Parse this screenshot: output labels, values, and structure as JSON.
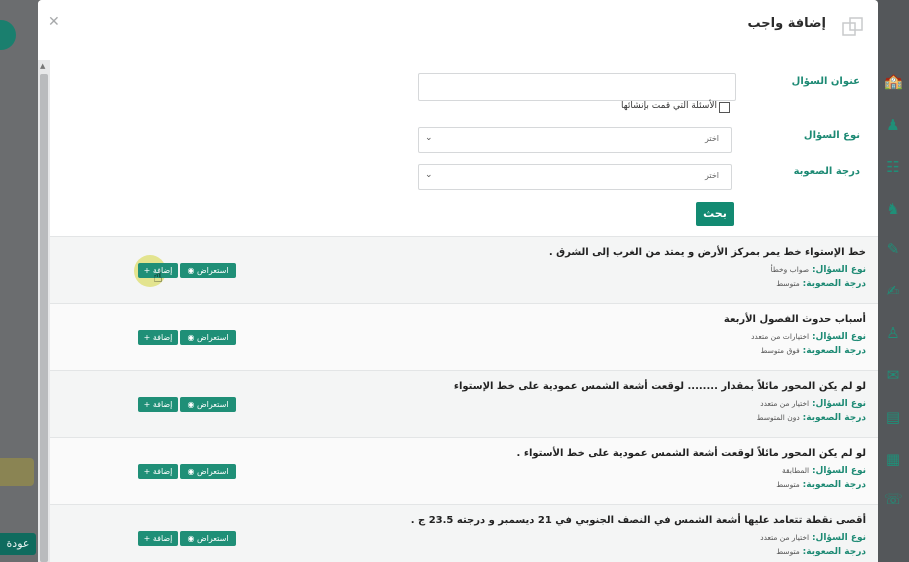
{
  "background": {
    "back_button_label": "عودة"
  },
  "modal": {
    "title": "إضافة واجب",
    "title_icon": "copy-icon",
    "close_icon": "close-icon"
  },
  "form": {
    "question_title_label": "عنوان السؤال",
    "question_title_value": "",
    "my_questions_checkbox_label": "الأسئلة التي قمت بإنشائها",
    "question_type_label": "نوع السؤال",
    "question_type_value": "اختر",
    "difficulty_label": "درجة الصعوبة",
    "difficulty_value": "اختر",
    "search_button": "بحث"
  },
  "meta_labels": {
    "type": "نوع السؤال:",
    "difficulty": "درجة الصعوبة:"
  },
  "actions": {
    "view_label": "استعراض",
    "add_label": "إضافة"
  },
  "questions": [
    {
      "text": "خط الإستواء خط يمر بمركز الأرض و يمتد من الغرب إلى الشرق .",
      "type": "صواب وخطأ",
      "difficulty": "متوسط"
    },
    {
      "text": "أسباب حدوث الفصول الأربعة",
      "type": "اختيارات من متعدد",
      "difficulty": "فوق متوسط"
    },
    {
      "text": "لو لم يكن المحور مائلاً  بمقدار        ........     لوقعت أشعة الشمس عمودية على خط الإستواء",
      "type": "اختيار من متعدد",
      "difficulty": "دون المتوسط"
    },
    {
      "text": "لو لم يكن المحور مائلاً لوقعت أشعة الشمس عمودية على خط الأستواء  .",
      "type": "المطابقة",
      "difficulty": "متوسط"
    },
    {
      "text": "أقصى نقطة تتعامد عليها أشعة الشمس في النصف الجنوبي في 21 ديسمبر و درجته 23.5 ج .",
      "type": "اختيار من متعدد",
      "difficulty": "متوسط"
    }
  ],
  "sidebar_icons": [
    "school-icon",
    "teacher-icon",
    "calendar-settings-icon",
    "chess-knight-icon",
    "edit-icon",
    "edit-note-icon",
    "family-icon",
    "chat-icon",
    "bar-chart-icon",
    "calendar-icon",
    "headset-icon"
  ],
  "colors": {
    "accent": "#1d8a74",
    "button": "#1f8f77",
    "overlay": "#5f6163"
  }
}
